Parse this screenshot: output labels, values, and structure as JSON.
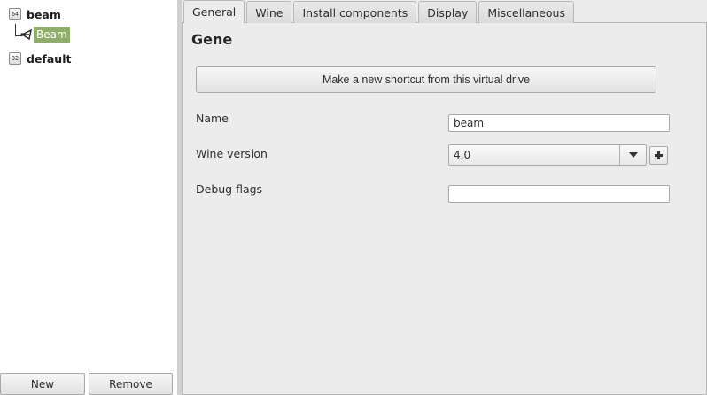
{
  "tree": {
    "items": [
      {
        "arch": "64",
        "label": "beam",
        "icon": "arch-64-icon"
      },
      {
        "arch": "32",
        "label": "default",
        "icon": "arch-32-icon"
      }
    ],
    "child": {
      "label": "Beam",
      "icon": "shortcut-icon",
      "selected_color": "#8fae6a"
    }
  },
  "left_buttons": {
    "new_label": "New",
    "remove_label": "Remove"
  },
  "tabs": [
    {
      "label": "General",
      "active": true
    },
    {
      "label": "Wine",
      "active": false
    },
    {
      "label": "Install components",
      "active": false
    },
    {
      "label": "Display",
      "active": false
    },
    {
      "label": "Miscellaneous",
      "active": false
    }
  ],
  "general": {
    "title": "Gene",
    "shortcut_button_label": "Make a new shortcut from this virtual drive",
    "name_label": "Name",
    "name_value": "beam",
    "wine_version_label": "Wine version",
    "wine_version_value": "4.0",
    "debug_flags_label": "Debug flags",
    "debug_flags_value": ""
  }
}
